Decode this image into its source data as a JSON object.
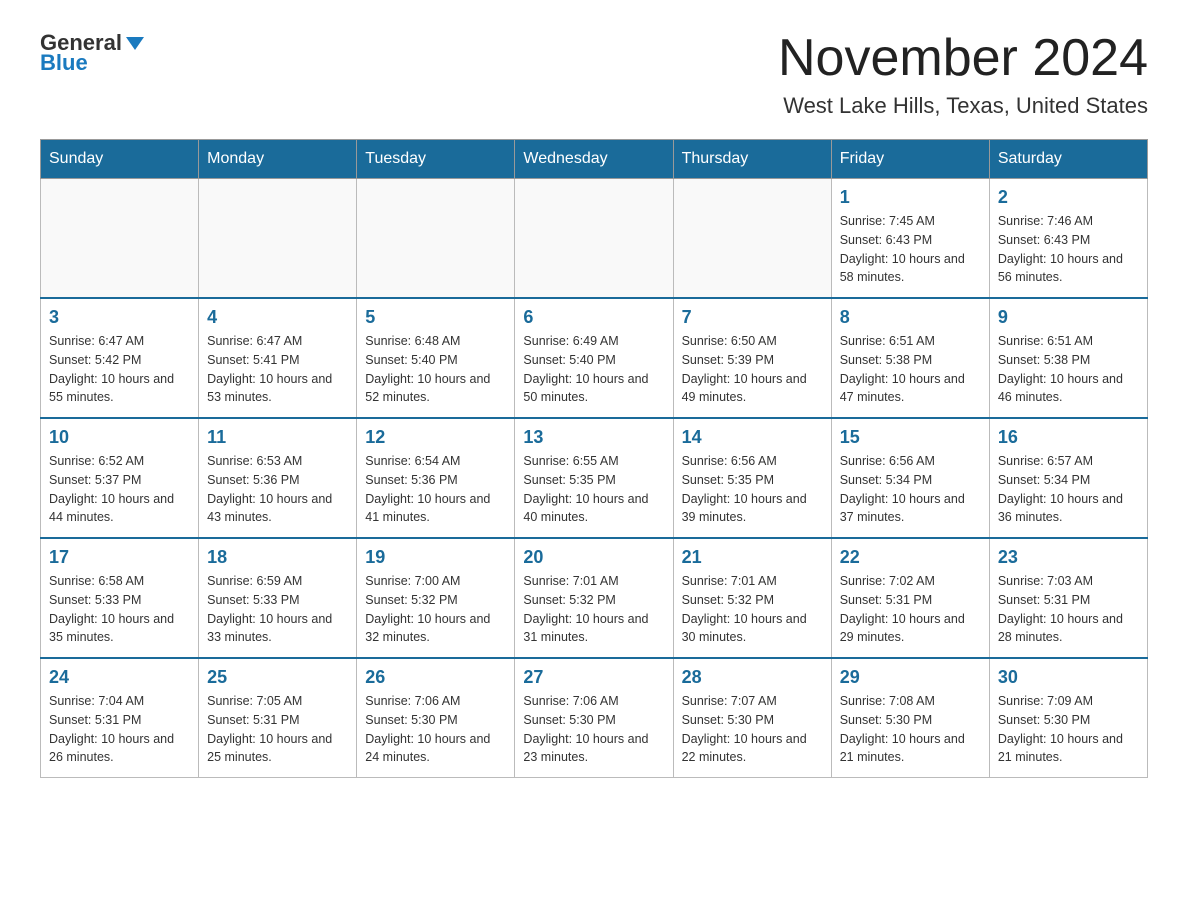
{
  "header": {
    "logo_general": "General",
    "logo_blue": "Blue",
    "month_title": "November 2024",
    "location": "West Lake Hills, Texas, United States"
  },
  "weekdays": [
    "Sunday",
    "Monday",
    "Tuesday",
    "Wednesday",
    "Thursday",
    "Friday",
    "Saturday"
  ],
  "weeks": [
    [
      {
        "day": "",
        "info": ""
      },
      {
        "day": "",
        "info": ""
      },
      {
        "day": "",
        "info": ""
      },
      {
        "day": "",
        "info": ""
      },
      {
        "day": "",
        "info": ""
      },
      {
        "day": "1",
        "info": "Sunrise: 7:45 AM\nSunset: 6:43 PM\nDaylight: 10 hours and 58 minutes."
      },
      {
        "day": "2",
        "info": "Sunrise: 7:46 AM\nSunset: 6:43 PM\nDaylight: 10 hours and 56 minutes."
      }
    ],
    [
      {
        "day": "3",
        "info": "Sunrise: 6:47 AM\nSunset: 5:42 PM\nDaylight: 10 hours and 55 minutes."
      },
      {
        "day": "4",
        "info": "Sunrise: 6:47 AM\nSunset: 5:41 PM\nDaylight: 10 hours and 53 minutes."
      },
      {
        "day": "5",
        "info": "Sunrise: 6:48 AM\nSunset: 5:40 PM\nDaylight: 10 hours and 52 minutes."
      },
      {
        "day": "6",
        "info": "Sunrise: 6:49 AM\nSunset: 5:40 PM\nDaylight: 10 hours and 50 minutes."
      },
      {
        "day": "7",
        "info": "Sunrise: 6:50 AM\nSunset: 5:39 PM\nDaylight: 10 hours and 49 minutes."
      },
      {
        "day": "8",
        "info": "Sunrise: 6:51 AM\nSunset: 5:38 PM\nDaylight: 10 hours and 47 minutes."
      },
      {
        "day": "9",
        "info": "Sunrise: 6:51 AM\nSunset: 5:38 PM\nDaylight: 10 hours and 46 minutes."
      }
    ],
    [
      {
        "day": "10",
        "info": "Sunrise: 6:52 AM\nSunset: 5:37 PM\nDaylight: 10 hours and 44 minutes."
      },
      {
        "day": "11",
        "info": "Sunrise: 6:53 AM\nSunset: 5:36 PM\nDaylight: 10 hours and 43 minutes."
      },
      {
        "day": "12",
        "info": "Sunrise: 6:54 AM\nSunset: 5:36 PM\nDaylight: 10 hours and 41 minutes."
      },
      {
        "day": "13",
        "info": "Sunrise: 6:55 AM\nSunset: 5:35 PM\nDaylight: 10 hours and 40 minutes."
      },
      {
        "day": "14",
        "info": "Sunrise: 6:56 AM\nSunset: 5:35 PM\nDaylight: 10 hours and 39 minutes."
      },
      {
        "day": "15",
        "info": "Sunrise: 6:56 AM\nSunset: 5:34 PM\nDaylight: 10 hours and 37 minutes."
      },
      {
        "day": "16",
        "info": "Sunrise: 6:57 AM\nSunset: 5:34 PM\nDaylight: 10 hours and 36 minutes."
      }
    ],
    [
      {
        "day": "17",
        "info": "Sunrise: 6:58 AM\nSunset: 5:33 PM\nDaylight: 10 hours and 35 minutes."
      },
      {
        "day": "18",
        "info": "Sunrise: 6:59 AM\nSunset: 5:33 PM\nDaylight: 10 hours and 33 minutes."
      },
      {
        "day": "19",
        "info": "Sunrise: 7:00 AM\nSunset: 5:32 PM\nDaylight: 10 hours and 32 minutes."
      },
      {
        "day": "20",
        "info": "Sunrise: 7:01 AM\nSunset: 5:32 PM\nDaylight: 10 hours and 31 minutes."
      },
      {
        "day": "21",
        "info": "Sunrise: 7:01 AM\nSunset: 5:32 PM\nDaylight: 10 hours and 30 minutes."
      },
      {
        "day": "22",
        "info": "Sunrise: 7:02 AM\nSunset: 5:31 PM\nDaylight: 10 hours and 29 minutes."
      },
      {
        "day": "23",
        "info": "Sunrise: 7:03 AM\nSunset: 5:31 PM\nDaylight: 10 hours and 28 minutes."
      }
    ],
    [
      {
        "day": "24",
        "info": "Sunrise: 7:04 AM\nSunset: 5:31 PM\nDaylight: 10 hours and 26 minutes."
      },
      {
        "day": "25",
        "info": "Sunrise: 7:05 AM\nSunset: 5:31 PM\nDaylight: 10 hours and 25 minutes."
      },
      {
        "day": "26",
        "info": "Sunrise: 7:06 AM\nSunset: 5:30 PM\nDaylight: 10 hours and 24 minutes."
      },
      {
        "day": "27",
        "info": "Sunrise: 7:06 AM\nSunset: 5:30 PM\nDaylight: 10 hours and 23 minutes."
      },
      {
        "day": "28",
        "info": "Sunrise: 7:07 AM\nSunset: 5:30 PM\nDaylight: 10 hours and 22 minutes."
      },
      {
        "day": "29",
        "info": "Sunrise: 7:08 AM\nSunset: 5:30 PM\nDaylight: 10 hours and 21 minutes."
      },
      {
        "day": "30",
        "info": "Sunrise: 7:09 AM\nSunset: 5:30 PM\nDaylight: 10 hours and 21 minutes."
      }
    ]
  ]
}
